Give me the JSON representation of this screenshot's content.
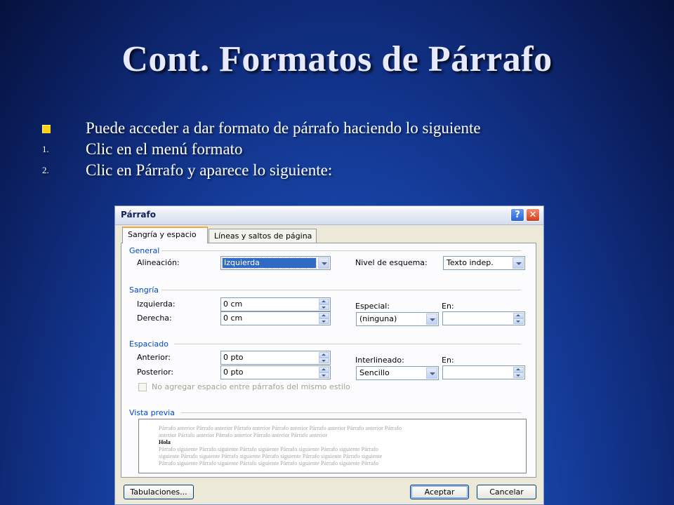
{
  "slide": {
    "title": "Cont. Formatos de Párrafo",
    "bullets": [
      {
        "marker": "",
        "text": "Puede acceder a dar formato de párrafo haciendo lo siguiente"
      },
      {
        "marker": "1.",
        "text": "Clic en el menú formato"
      },
      {
        "marker": "2.",
        "text": "Clic en Párrafo y aparece lo siguiente:"
      }
    ]
  },
  "dialog": {
    "title": "Párrafo",
    "tabs": [
      "Sangría y espacio",
      "Líneas y saltos de página"
    ],
    "general": {
      "group": "General",
      "alignment_label": "Alineación:",
      "alignment_value": "Izquierda",
      "outline_label": "Nivel de esquema:",
      "outline_value": "Texto indep."
    },
    "indent": {
      "group": "Sangría",
      "left_label": "Izquierda:",
      "left_value": "0 cm",
      "right_label": "Derecha:",
      "right_value": "0 cm",
      "special_label": "Especial:",
      "special_value": "(ninguna)",
      "by_label": "En:",
      "by_value": ""
    },
    "spacing": {
      "group": "Espaciado",
      "before_label": "Anterior:",
      "before_value": "0 pto",
      "after_label": "Posterior:",
      "after_value": "0 pto",
      "line_label": "Interlineado:",
      "line_value": "Sencillo",
      "at_label": "En:",
      "at_value": "",
      "no_space_label": "No agregar espacio entre párrafos del mismo estilo",
      "no_space_checked": false
    },
    "preview": {
      "group": "Vista previa",
      "lines": [
        "Párrafo anterior Párrafo anterior Párrafo anterior Párrafo anterior Párrafo anterior Párrafo anterior Párrafo",
        "anterior Párrafo anterior Párrafo anterior Párrafo anterior Párrafo anterior",
        "Hola",
        "Párrafo siguiente Párrafo siguiente Párrafo siguiente Párrafo siguiente Párrafo siguiente Párrafo",
        "siguiente Párrafo siguiente Párrafo siguiente Párrafo siguiente Párrafo siguiente Párrafo siguiente",
        "Párrafo siguiente Párrafo siguiente Párrafo siguiente Párrafo siguiente Párrafo siguiente Párrafo"
      ]
    },
    "buttons": {
      "tabs": "Tabulaciones...",
      "ok": "Aceptar",
      "cancel": "Cancelar"
    }
  }
}
